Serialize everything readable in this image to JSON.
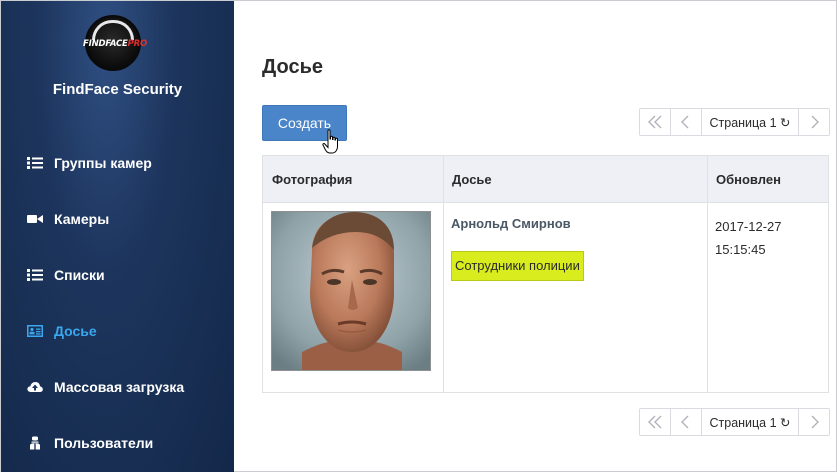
{
  "brand": {
    "logo_text_main": "FINDFACE",
    "logo_text_pro": "PRO",
    "title": "FindFace Security"
  },
  "sidebar": {
    "items": [
      {
        "label": "Группы камер",
        "icon": "list-icon",
        "active": false
      },
      {
        "label": "Камеры",
        "icon": "video-camera-icon",
        "active": false
      },
      {
        "label": "Списки",
        "icon": "list-icon",
        "active": false
      },
      {
        "label": "Досье",
        "icon": "id-card-icon",
        "active": true
      },
      {
        "label": "Массовая загрузка",
        "icon": "cloud-upload-icon",
        "active": false
      },
      {
        "label": "Пользователи",
        "icon": "users-icon",
        "active": false
      }
    ],
    "active_color": "#3aa7ee"
  },
  "main": {
    "title": "Досье",
    "create_label": "Создать",
    "pager": {
      "first": "«",
      "prev": "‹",
      "page_label": "Страница 1 ↻",
      "next": "›"
    },
    "table": {
      "columns": [
        "Фотография",
        "Досье",
        "Обновлен"
      ],
      "rows": [
        {
          "photo": "portrait",
          "name": "Арнольд Смирнов",
          "list_tag": "Сотрудники полиции",
          "updated_date": "2017-12-27",
          "updated_time": "15:15:45"
        }
      ]
    }
  },
  "colors": {
    "primary_button": "#4a84c9",
    "tag_background": "#d8ec1e",
    "sidebar_background": "#1d355d"
  }
}
